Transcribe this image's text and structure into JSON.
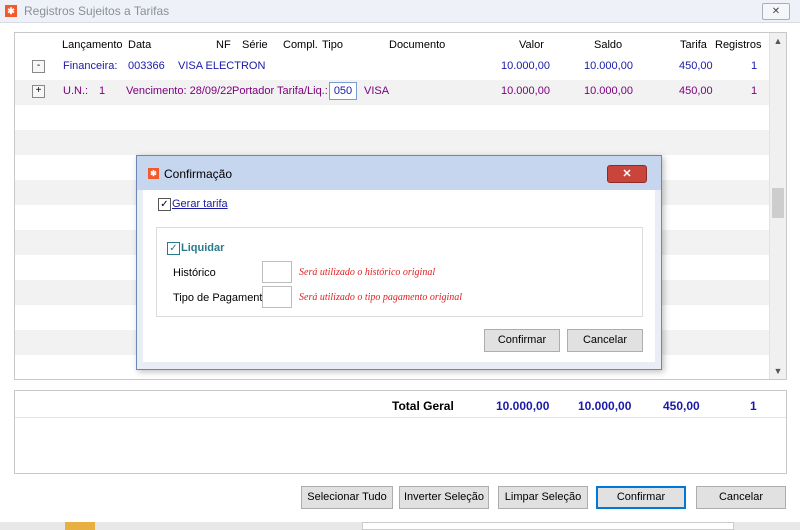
{
  "window": {
    "title": "Registros Sujeitos a Tarifas",
    "close_label": "✕"
  },
  "grid": {
    "headers": [
      "Lançamento",
      "Data",
      "NF",
      "Série",
      "Compl.",
      "Tipo",
      "Documento",
      "Valor",
      "Saldo",
      "Tarifa",
      "Registros"
    ],
    "row1": {
      "toggle": "-",
      "label": "Financeira:",
      "code": "003366",
      "name": "VISA ELECTRON",
      "valor": "10.000,00",
      "saldo": "10.000,00",
      "tarifa": "450,00",
      "registros": "1"
    },
    "row2": {
      "toggle": "+",
      "un_label": "U.N.:",
      "un_value": "1",
      "vencimento": "Vencimento: 28/09/22",
      "portador": "Portador Tarifa/Liq.:",
      "portador_code": "050",
      "portador_name": "VISA",
      "valor": "10.000,00",
      "saldo": "10.000,00",
      "tarifa": "450,00",
      "registros": "1"
    }
  },
  "totals": {
    "label": "Total Geral",
    "valor": "10.000,00",
    "saldo": "10.000,00",
    "tarifa": "450,00",
    "registros": "1"
  },
  "buttons": {
    "selecionar_tudo": "Selecionar Tudo",
    "inverter_selecao": "Inverter Seleção",
    "limpar_selecao": "Limpar Seleção",
    "confirmar": "Confirmar",
    "cancelar": "Cancelar"
  },
  "dialog": {
    "title": "Confirmação",
    "close_label": "✕",
    "gerar_tarifa": {
      "label": "Gerar tarifa",
      "checked": true
    },
    "liquidar": {
      "label": "Liquidar",
      "checked": true
    },
    "historico": {
      "label": "Histórico",
      "value": "",
      "hint": "Será utilizado o histórico original"
    },
    "tipo_pagamento": {
      "label": "Tipo de Pagamento",
      "value": "",
      "hint": "Será utilizado o tipo pagamento original"
    },
    "confirmar_label": "Confirmar",
    "cancelar_label": "Cancelar"
  }
}
